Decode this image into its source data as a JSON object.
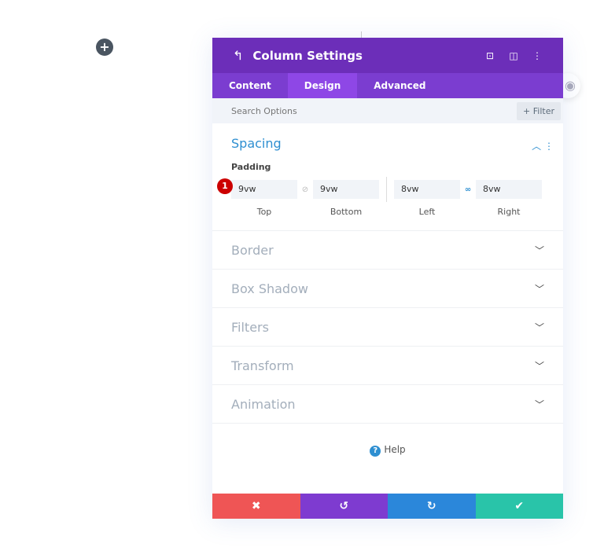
{
  "canvas": {
    "add_icon": "plus-icon"
  },
  "panel": {
    "title": "Column Settings",
    "header_icons": [
      "back-arrow-icon",
      "focus-icon",
      "split-view-icon",
      "more-icon"
    ],
    "tabs": [
      {
        "label": "Content",
        "active": false
      },
      {
        "label": "Design",
        "active": true
      },
      {
        "label": "Advanced",
        "active": false
      }
    ],
    "search": {
      "placeholder": "Search Options",
      "filter_label": "+ Filter"
    },
    "spacing": {
      "title": "Spacing",
      "padding_label": "Padding",
      "badge": "1",
      "fields": [
        {
          "label": "Top",
          "value": "9vw"
        },
        {
          "label": "Bottom",
          "value": "9vw"
        },
        {
          "label": "Left",
          "value": "8vw"
        },
        {
          "label": "Right",
          "value": "8vw"
        }
      ],
      "top_bottom_linked": false,
      "left_right_linked": true
    },
    "sections": [
      "Border",
      "Box Shadow",
      "Filters",
      "Transform",
      "Animation"
    ],
    "help_label": "Help",
    "footer": {
      "colors": {
        "cancel": "#ef5555",
        "undo": "#7e3bd0",
        "redo": "#2b87da",
        "save": "#29c4a9"
      }
    }
  }
}
